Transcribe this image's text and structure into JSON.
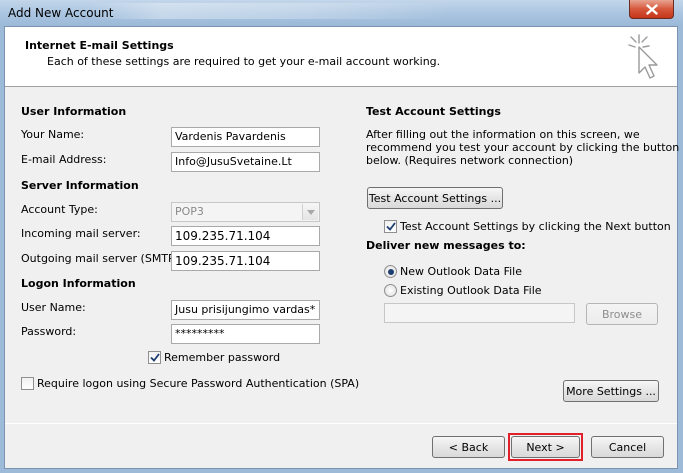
{
  "window": {
    "title": "Add New Account"
  },
  "header": {
    "title": "Internet E-mail Settings",
    "subtitle": "Each of these settings are required to get your e-mail account working.",
    "icon": "cursor-sparkle-icon"
  },
  "user_info": {
    "section": "User Information",
    "name_label": "Your Name:",
    "name_value": "Vardenis Pavardenis",
    "email_label": "E-mail Address:",
    "email_value": "Info@JusuSvetaine.Lt"
  },
  "server_info": {
    "section": "Server Information",
    "account_type_label": "Account Type:",
    "account_type_value": "POP3",
    "incoming_label": "Incoming mail server:",
    "incoming_value": "109.235.71.104",
    "outgoing_label": "Outgoing mail server (SMTP):",
    "outgoing_value": "109.235.71.104"
  },
  "logon_info": {
    "section": "Logon Information",
    "username_label": "User Name:",
    "username_value": "Jusu prisijungimo vardas*",
    "password_label": "Password:",
    "password_value": "*********",
    "remember_label": "Remember password",
    "remember_checked": true,
    "spa_label": "Require logon using Secure Password Authentication (SPA)",
    "spa_checked": false
  },
  "test_settings": {
    "section": "Test Account Settings",
    "description": [
      "After filling out the information on this screen, we",
      "recommend you test your account by clicking the button",
      "below. (Requires network connection)"
    ],
    "test_button": "Test Account Settings ...",
    "auto_test_label": "Test Account Settings by clicking the Next button",
    "auto_test_checked": true
  },
  "deliver": {
    "section": "Deliver new messages to:",
    "options": [
      {
        "label": "New Outlook Data File",
        "selected": true
      },
      {
        "label": "Existing Outlook Data File",
        "selected": false
      }
    ],
    "browse_button": "Browse",
    "path_value": ""
  },
  "more_settings_button": "More Settings ...",
  "footer": {
    "back": "< Back",
    "next": "Next >",
    "cancel": "Cancel"
  },
  "colors": {
    "highlight_outline": "#e0202a",
    "close_button": "#d6583a"
  }
}
